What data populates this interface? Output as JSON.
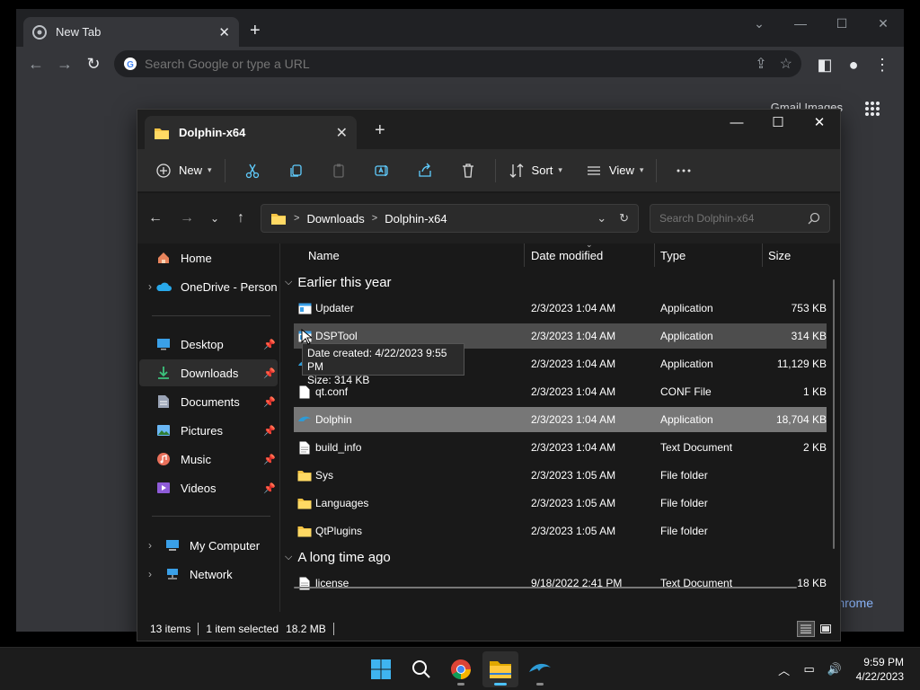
{
  "chrome": {
    "tab_title": "New Tab",
    "omnibox_placeholder": "Search Google or type a URL",
    "ntp_links": "Gmail   Images",
    "customize_label": "Customize Chrome",
    "customize_visible": "hrome"
  },
  "explorer": {
    "tab_title": "Dolphin-x64",
    "toolbar": {
      "new_label": "New",
      "sort_label": "Sort",
      "view_label": "View"
    },
    "breadcrumb": [
      "Downloads",
      "Dolphin-x64"
    ],
    "search_placeholder": "Search Dolphin-x64",
    "sidebar": {
      "home": "Home",
      "onedrive": "OneDrive - Persona",
      "desktop": "Desktop",
      "downloads": "Downloads",
      "documents": "Documents",
      "pictures": "Pictures",
      "music": "Music",
      "videos": "Videos",
      "my_computer": "My Computer",
      "network": "Network"
    },
    "columns": {
      "name": "Name",
      "date": "Date modified",
      "type": "Type",
      "size": "Size"
    },
    "groups": {
      "earlier": "Earlier this year",
      "longago": "A long time ago"
    },
    "files": [
      {
        "name": "Updater",
        "date": "2/3/2023 1:04 AM",
        "type": "Application",
        "size": "753 KB"
      },
      {
        "name": "DSPTool",
        "date": "2/3/2023 1:04 AM",
        "type": "Application",
        "size": "314 KB"
      },
      {
        "name": "",
        "date": "2/3/2023 1:04 AM",
        "type": "Application",
        "size": "11,129 KB"
      },
      {
        "name": "qt.conf",
        "date": "2/3/2023 1:04 AM",
        "type": "CONF File",
        "size": "1 KB"
      },
      {
        "name": "Dolphin",
        "date": "2/3/2023 1:04 AM",
        "type": "Application",
        "size": "18,704 KB"
      },
      {
        "name": "build_info",
        "date": "2/3/2023 1:04 AM",
        "type": "Text Document",
        "size": "2 KB"
      },
      {
        "name": "Sys",
        "date": "2/3/2023 1:05 AM",
        "type": "File folder",
        "size": ""
      },
      {
        "name": "Languages",
        "date": "2/3/2023 1:05 AM",
        "type": "File folder",
        "size": ""
      },
      {
        "name": "QtPlugins",
        "date": "2/3/2023 1:05 AM",
        "type": "File folder",
        "size": ""
      },
      {
        "name": "license",
        "date": "9/18/2022 2:41 PM",
        "type": "Text Document",
        "size": "18 KB"
      }
    ],
    "tooltip": {
      "line1": "Date created: 4/22/2023 9:55 PM",
      "line2": "Size: 314 KB"
    },
    "status": {
      "items": "13 items",
      "selected": "1 item selected",
      "size": "18.2 MB"
    }
  },
  "taskbar": {
    "time": "9:59 PM",
    "date": "4/22/2023"
  },
  "colors": {
    "accent": "#4cc2ff",
    "folder": "#f6c444",
    "chrome_bg": "#35363a",
    "explorer_bg": "#191919"
  }
}
